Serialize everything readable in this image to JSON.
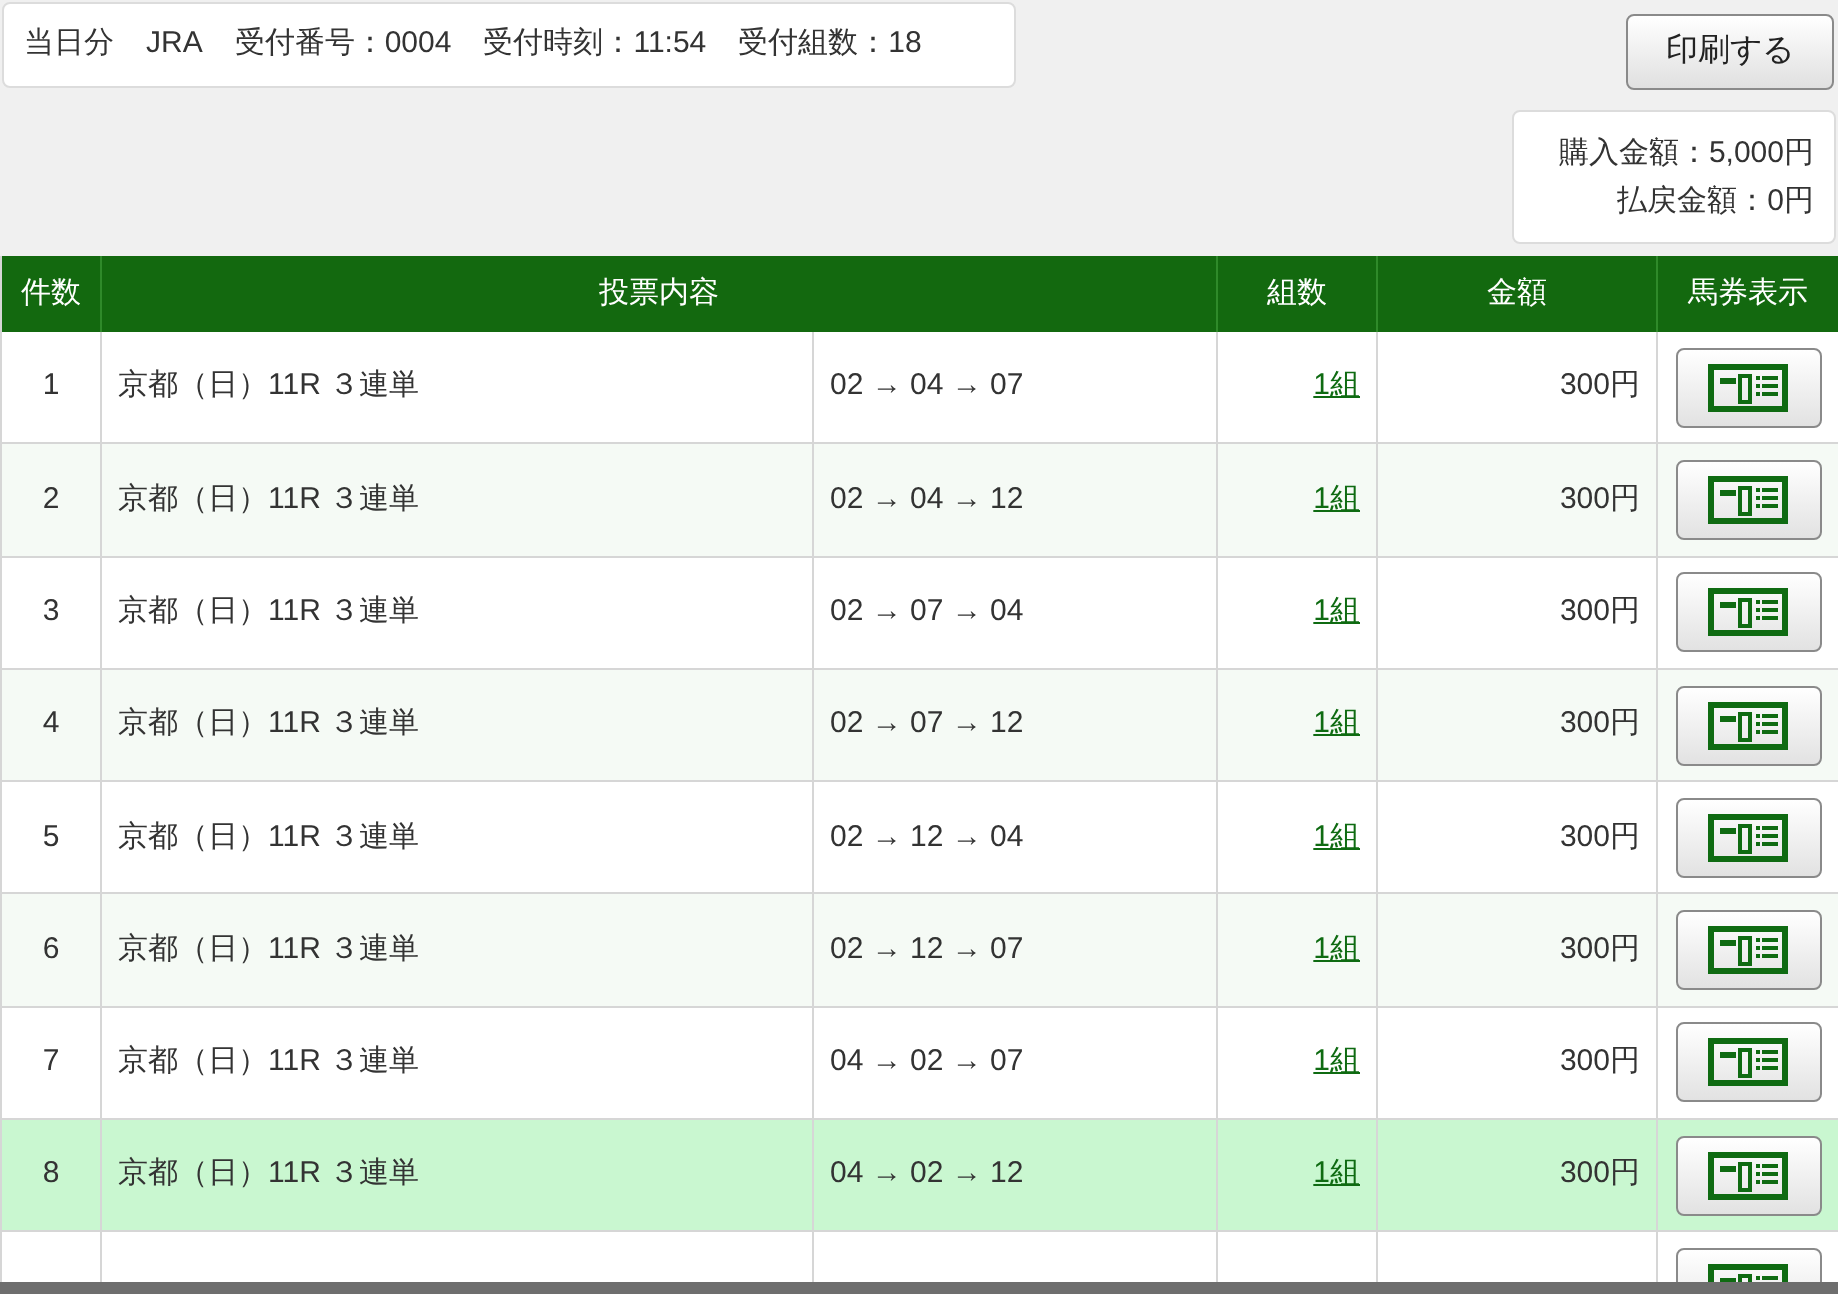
{
  "receipt": {
    "day": "当日分",
    "org": "JRA",
    "number": "受付番号：0004",
    "time": "受付時刻：11:54",
    "count": "受付組数：18"
  },
  "print_button": "印刷する",
  "totals": {
    "purchase": "購入金額：5,000円",
    "payout": "払戻金額：0円"
  },
  "table": {
    "columns": [
      "件数",
      "投票内容",
      "組数",
      "金額",
      "馬券表示"
    ],
    "rows": [
      {
        "no": "1",
        "race": "京都（日）11R ３連単",
        "combo": "02 → 04 → 07",
        "sets": "1組",
        "amount": "300円",
        "selected": false
      },
      {
        "no": "2",
        "race": "京都（日）11R ３連単",
        "combo": "02 → 04 → 12",
        "sets": "1組",
        "amount": "300円",
        "selected": false
      },
      {
        "no": "3",
        "race": "京都（日）11R ３連単",
        "combo": "02 → 07 → 04",
        "sets": "1組",
        "amount": "300円",
        "selected": false
      },
      {
        "no": "4",
        "race": "京都（日）11R ３連単",
        "combo": "02 → 07 → 12",
        "sets": "1組",
        "amount": "300円",
        "selected": false
      },
      {
        "no": "5",
        "race": "京都（日）11R ３連単",
        "combo": "02 → 12 → 04",
        "sets": "1組",
        "amount": "300円",
        "selected": false
      },
      {
        "no": "6",
        "race": "京都（日）11R ３連単",
        "combo": "02 → 12 → 07",
        "sets": "1組",
        "amount": "300円",
        "selected": false
      },
      {
        "no": "7",
        "race": "京都（日）11R ３連単",
        "combo": "04 → 02 → 07",
        "sets": "1組",
        "amount": "300円",
        "selected": false
      },
      {
        "no": "8",
        "race": "京都（日）11R ３連単",
        "combo": "04 → 02 → 12",
        "sets": "1組",
        "amount": "300円",
        "selected": true
      }
    ]
  }
}
